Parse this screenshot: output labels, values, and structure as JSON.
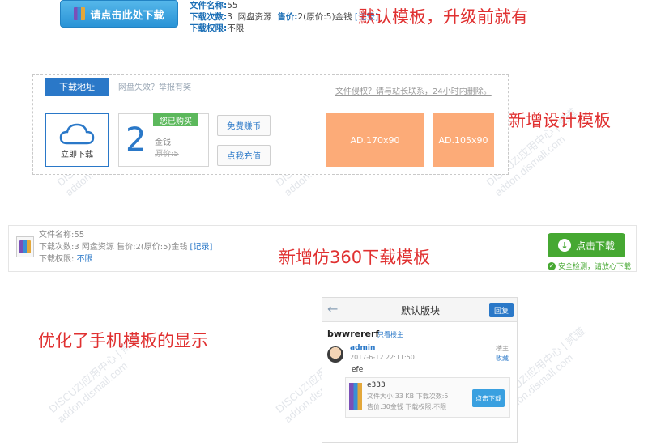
{
  "section1": {
    "download_button": "请点击此处下载",
    "filename_label": "文件名称:",
    "filename_value": "55",
    "downloads_label": "下载次数:",
    "downloads_value": "3",
    "source": "网盘资源",
    "price_label": "售价:",
    "price_value": "2(原价:5)金钱",
    "record": "[记录]",
    "perm_label": "下载权限:",
    "perm_value": "不限",
    "caption": "默认模板，升级前就有"
  },
  "section2": {
    "tab_label": "下载地址",
    "fail_link": "网盘失效？举报有奖",
    "notice": "文件侵权？请与站长联系，24小时内删除。",
    "cloud_label": "立即下载",
    "price_number": "2",
    "bought_badge": "您已购买",
    "unit": "金钱",
    "original": "原价:5",
    "earn_button": "免费赚币",
    "recharge_button": "点我充值",
    "ad1": "AD.170x90",
    "ad2": "AD.105x90",
    "caption": "新增设计模板"
  },
  "section3": {
    "filename_line": "文件名称:55",
    "downloads_line": "下载次数:3   网盘资源   售价:2(原价:5)金钱",
    "record": "[记录]",
    "perm_label": "下载权限:",
    "perm_value": "不限",
    "download_button": "点击下载",
    "safe_note": "安全检测，请放心下载",
    "caption": "新增仿360下载模板"
  },
  "section4": {
    "caption": "优化了手机模板的显示",
    "header_title": "默认版块",
    "reply_button": "回复",
    "thread_title": "bwwrererf",
    "only_owner": "只看楼主",
    "username": "admin",
    "date": "2017-6-12 22:11:50",
    "owner_tag": "楼主",
    "favorite": "收藏",
    "post_body": "efe",
    "att_name": "e333",
    "att_size": "文件大小:33 KB   下载次数:5",
    "att_price": "售价:30金钱   下载权限:不限",
    "att_download": "点击下载"
  },
  "watermark": {
    "line1": "DISCUZ!应用中心 | 贰道",
    "line2": "addon.dismall.com"
  },
  "colors": {
    "accent_blue": "#2a78c8",
    "caption_red": "#e03030",
    "ad_orange": "#fcab78",
    "download_green": "#46a832"
  }
}
